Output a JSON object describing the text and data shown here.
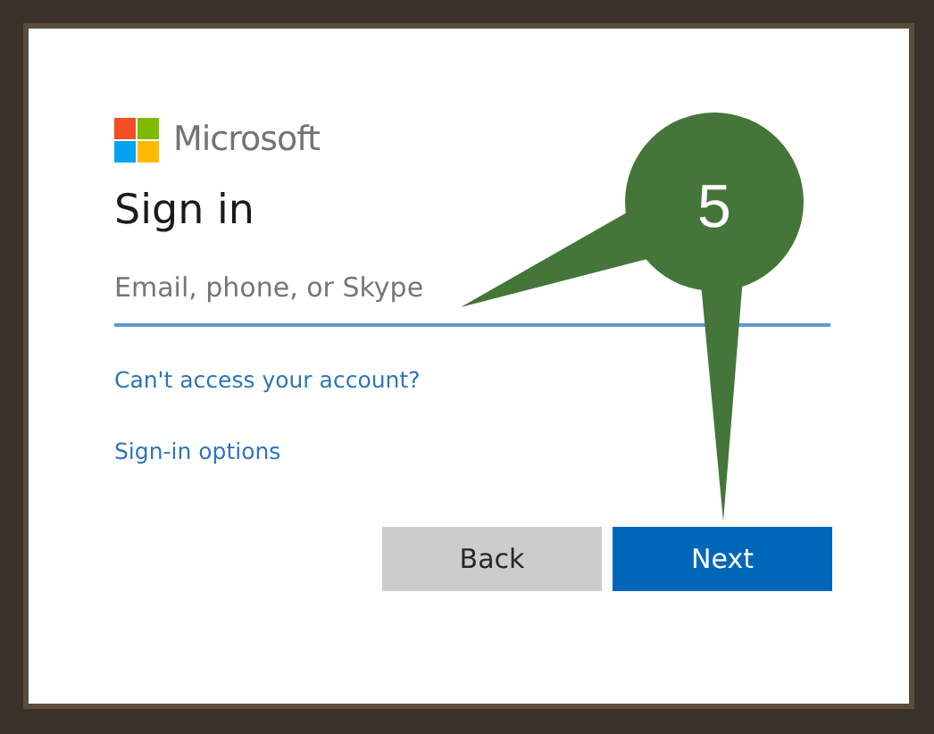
{
  "brand": {
    "name": "Microsoft"
  },
  "title": "Sign in",
  "email_field": {
    "placeholder": "Email, phone, or Skype"
  },
  "links": [
    "Can't access your account?",
    "Sign-in options"
  ],
  "buttons": [
    {
      "label": "Back",
      "kind": "secondary"
    },
    {
      "label": "Next",
      "kind": "primary"
    }
  ],
  "callout": {
    "number": "5"
  }
}
